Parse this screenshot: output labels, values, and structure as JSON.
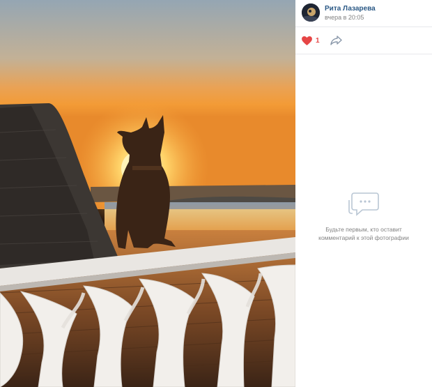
{
  "author": {
    "name": "Рита Лазарева",
    "time": "вчера в 20:05"
  },
  "actions": {
    "likes": "1",
    "like_icon": "heart-icon",
    "share_icon": "share-arrow-icon"
  },
  "comments": {
    "empty_line1": "Будьте первым, кто оставит",
    "empty_line2": "комментарий к этой фотографии",
    "icon": "comments-icon"
  },
  "colors": {
    "link": "#2a5885",
    "like": "#e64646",
    "muted": "#828282"
  }
}
